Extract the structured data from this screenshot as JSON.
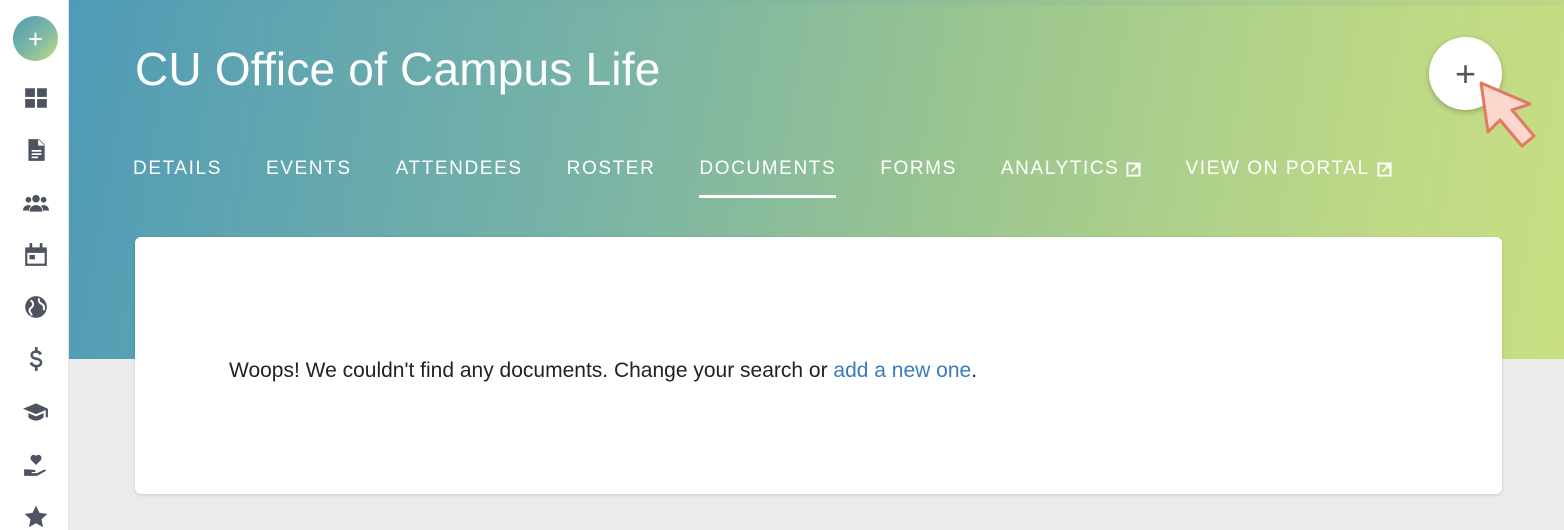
{
  "sidebar": {
    "add_label": "+",
    "items": [
      {
        "icon": "dashboard-icon"
      },
      {
        "icon": "document-icon"
      },
      {
        "icon": "users-icon"
      },
      {
        "icon": "calendar-icon"
      },
      {
        "icon": "globe-icon"
      },
      {
        "icon": "dollar-icon"
      },
      {
        "icon": "graduation-cap-icon"
      },
      {
        "icon": "hand-heart-icon"
      },
      {
        "icon": "star-icon"
      }
    ]
  },
  "header": {
    "title": "CU Office of Campus Life",
    "fab_label": "+",
    "tabs": [
      {
        "label": "DETAILS",
        "active": false
      },
      {
        "label": "EVENTS",
        "active": false
      },
      {
        "label": "ATTENDEES",
        "active": false
      },
      {
        "label": "ROSTER",
        "active": false
      },
      {
        "label": "DOCUMENTS",
        "active": true
      },
      {
        "label": "FORMS",
        "active": false
      },
      {
        "label": "ANALYTICS",
        "active": false,
        "external": true
      },
      {
        "label": "VIEW ON PORTAL",
        "active": false,
        "external": true
      }
    ]
  },
  "card": {
    "message_prefix": "Woops! We couldn't find any documents.  Change your search or ",
    "link_text": "add a new one",
    "message_suffix": "."
  },
  "colors": {
    "gradient_start": "#4f9bb7",
    "gradient_end": "#c9de82",
    "link": "#3a7bbf",
    "sidebar_icon": "#4d5460"
  }
}
